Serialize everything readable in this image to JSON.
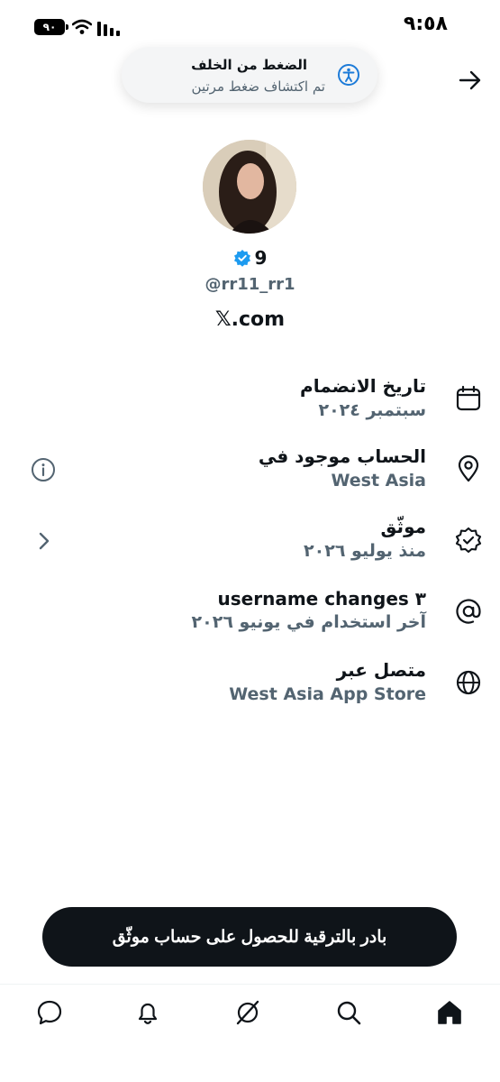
{
  "status_bar": {
    "time": "٩:٥٨",
    "battery": "٩٠"
  },
  "toast": {
    "title": "الضغط من الخلف",
    "subtitle": "تم اكتشاف ضغط مرتين"
  },
  "profile": {
    "name": "9",
    "handle": "@rr11_rr1",
    "site": "𝕏.com"
  },
  "info_rows": [
    {
      "title": "تاريخ الانضمام",
      "subtitle": "سبتمبر ٢٠٢٤",
      "icon": "calendar-icon"
    },
    {
      "title": "الحساب موجود في",
      "subtitle": "West Asia",
      "icon": "location-pin-icon"
    },
    {
      "title": "موثّق",
      "subtitle": "منذ يوليو ٢٠٢٦",
      "icon": "verified-badge-icon"
    },
    {
      "title": "٣ username changes",
      "subtitle": "آخر استخدام في يونيو ٢٠٢٦",
      "icon": "at-sign-icon"
    },
    {
      "title": "متصل عبر",
      "subtitle": "West Asia App Store",
      "icon": "globe-icon"
    }
  ],
  "cta": {
    "label": "بادر بالترقية للحصول على حساب موثّق"
  },
  "colors": {
    "primary_text": "#0f1419",
    "secondary_text": "#536471",
    "verified": "#1d9bf0"
  }
}
